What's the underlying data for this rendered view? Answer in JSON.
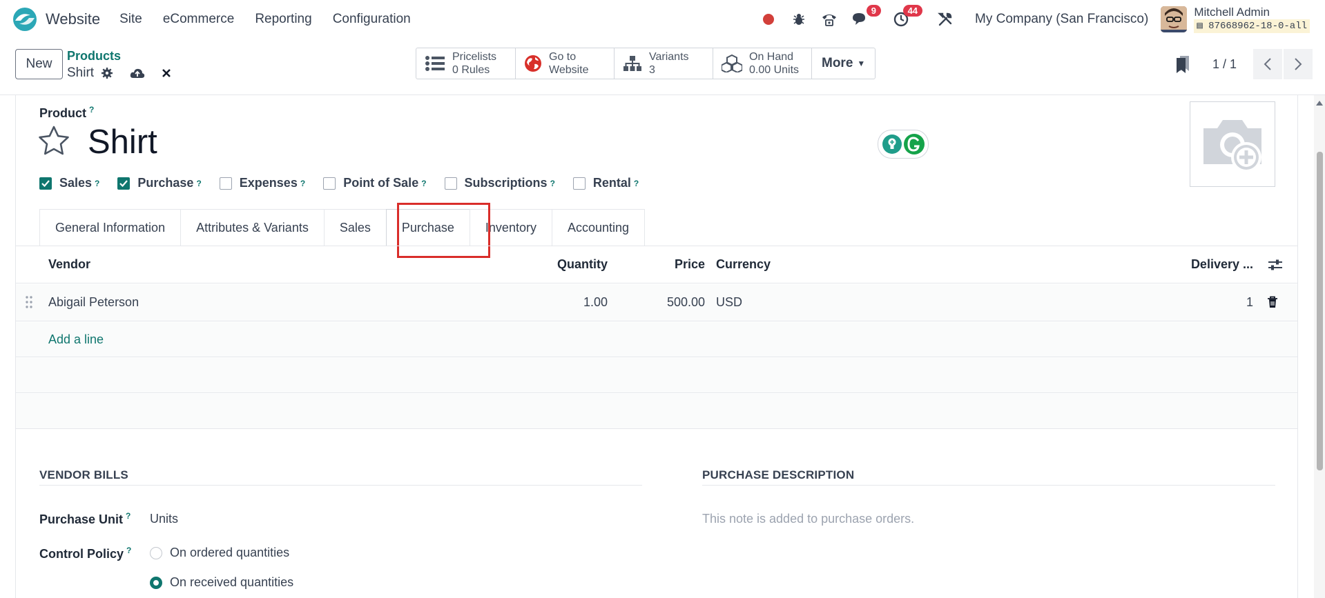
{
  "navbar": {
    "app_name": "Website",
    "menu": [
      "Site",
      "eCommerce",
      "Reporting",
      "Configuration"
    ],
    "messages_badge": "9",
    "activities_badge": "44",
    "company": "My Company (San Francisco)",
    "user_name": "Mitchell Admin",
    "db_name": "87668962-18-0-all"
  },
  "control": {
    "new_label": "New",
    "breadcrumb_parent": "Products",
    "breadcrumb_current": "Shirt",
    "smart_buttons": [
      {
        "title": "Pricelists",
        "value": "0  Rules",
        "icon": "list-icon"
      },
      {
        "title": "Go to",
        "value": "Website",
        "icon": "globe-icon"
      },
      {
        "title": "Variants",
        "value": "3",
        "icon": "sitemap-icon"
      },
      {
        "title": "On Hand",
        "value": "0.00 Units",
        "icon": "cubes-icon"
      }
    ],
    "more_label": "More",
    "pager": "1 / 1"
  },
  "form": {
    "product_label": "Product",
    "help_mark": "?",
    "name": "Shirt",
    "checkboxes": [
      {
        "label": "Sales",
        "checked": true
      },
      {
        "label": "Purchase",
        "checked": true
      },
      {
        "label": "Expenses",
        "checked": false
      },
      {
        "label": "Point of Sale",
        "checked": false
      },
      {
        "label": "Subscriptions",
        "checked": false
      },
      {
        "label": "Rental",
        "checked": false
      }
    ],
    "tabs": [
      "General Information",
      "Attributes & Variants",
      "Sales",
      "Purchase",
      "Inventory",
      "Accounting"
    ],
    "active_tab": "Purchase"
  },
  "vendor_table": {
    "headers": {
      "vendor": "Vendor",
      "quantity": "Quantity",
      "price": "Price",
      "currency": "Currency",
      "delivery": "Delivery ..."
    },
    "rows": [
      {
        "vendor": "Abigail Peterson",
        "quantity": "1.00",
        "price": "500.00",
        "currency": "USD",
        "delivery": "1"
      }
    ],
    "add_line": "Add a line"
  },
  "vendor_bills": {
    "title": "VENDOR BILLS",
    "purchase_unit_label": "Purchase Unit",
    "purchase_unit_value": "Units",
    "control_policy_label": "Control Policy",
    "options": [
      {
        "label": "On ordered quantities",
        "selected": false
      },
      {
        "label": "On received quantities",
        "selected": true
      }
    ]
  },
  "purchase_description": {
    "title": "PURCHASE DESCRIPTION",
    "placeholder": "This note is added to purchase orders."
  },
  "colors": {
    "accent": "#0f766e",
    "highlight": "#d92d2a",
    "badge": "#e0374a"
  }
}
